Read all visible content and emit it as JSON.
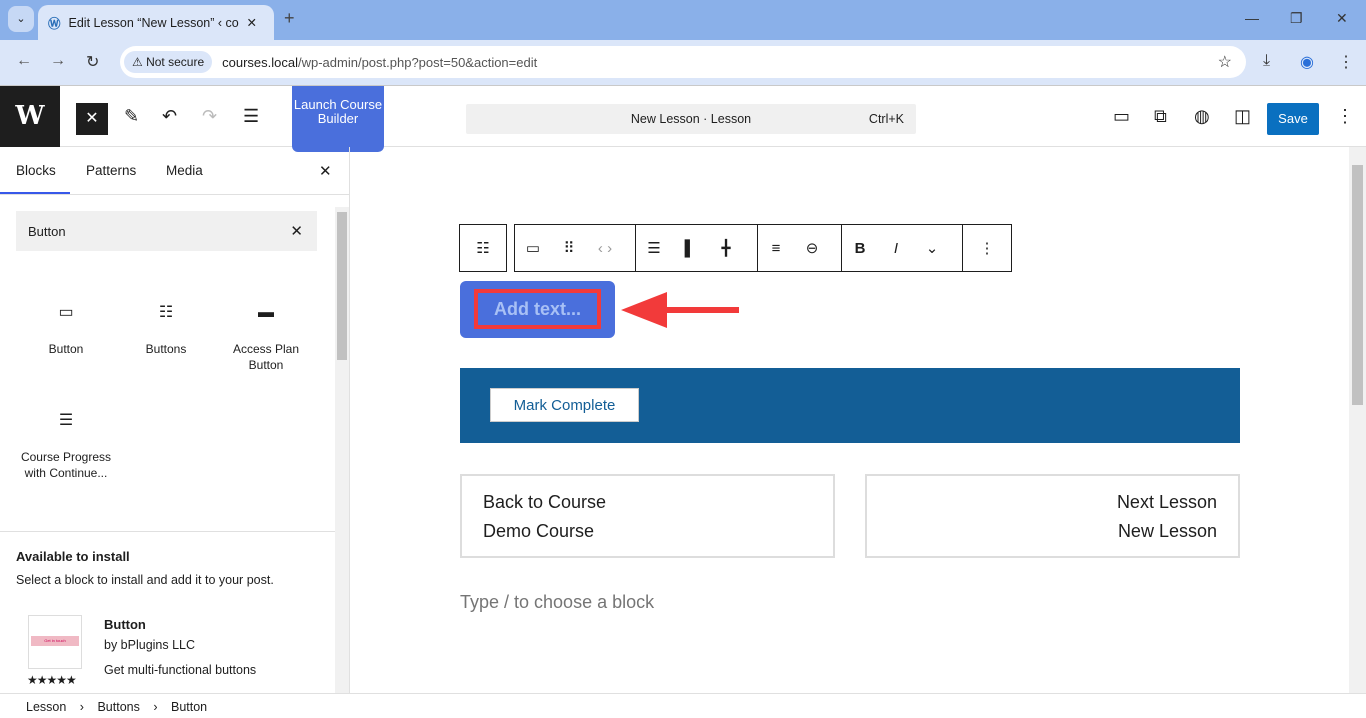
{
  "browser": {
    "tab_title": "Edit Lesson “New Lesson” ‹ courses",
    "security": "Not secure",
    "url_host": "courses.local",
    "url_path": "/wp-admin/post.php?post=50&action=edit"
  },
  "toolbar": {
    "launch": "Launch Course Builder",
    "command_title": "New Lesson · Lesson",
    "command_shortcut": "Ctrl+K",
    "save": "Save"
  },
  "sidebar": {
    "tabs": [
      "Blocks",
      "Patterns",
      "Media"
    ],
    "search_value": "Button",
    "blocks": [
      {
        "label": "Button",
        "icon": "button-icon"
      },
      {
        "label": "Buttons",
        "icon": "buttons-icon"
      },
      {
        "label": "Access Plan Button",
        "icon": "access-plan-icon"
      },
      {
        "label": "Course Progress with Continue...",
        "icon": "progress-icon"
      }
    ],
    "available_title": "Available to install",
    "available_sub": "Select a block to install and add it to your post.",
    "plugin": {
      "name": "Button",
      "author": "by bPlugins LLC",
      "desc": "Get multi-functional buttons",
      "rating": 5,
      "stars": "★★★★★",
      "thumb_text": "Get in touch"
    }
  },
  "canvas": {
    "button_placeholder": "Add text...",
    "mark_complete": "Mark Complete",
    "back_label": "Back to Course",
    "back_course": "Demo Course",
    "next_label": "Next Lesson",
    "next_lesson": "New Lesson",
    "block_placeholder": "Type / to choose a block"
  },
  "breadcrumb": [
    "Lesson",
    "Buttons",
    "Button"
  ],
  "colors": {
    "accent": "#3858e9",
    "button": "#4a6fdc",
    "mark_complete_bg": "#135e96",
    "annotation": "#f23a3a",
    "save": "#0a70c0"
  }
}
